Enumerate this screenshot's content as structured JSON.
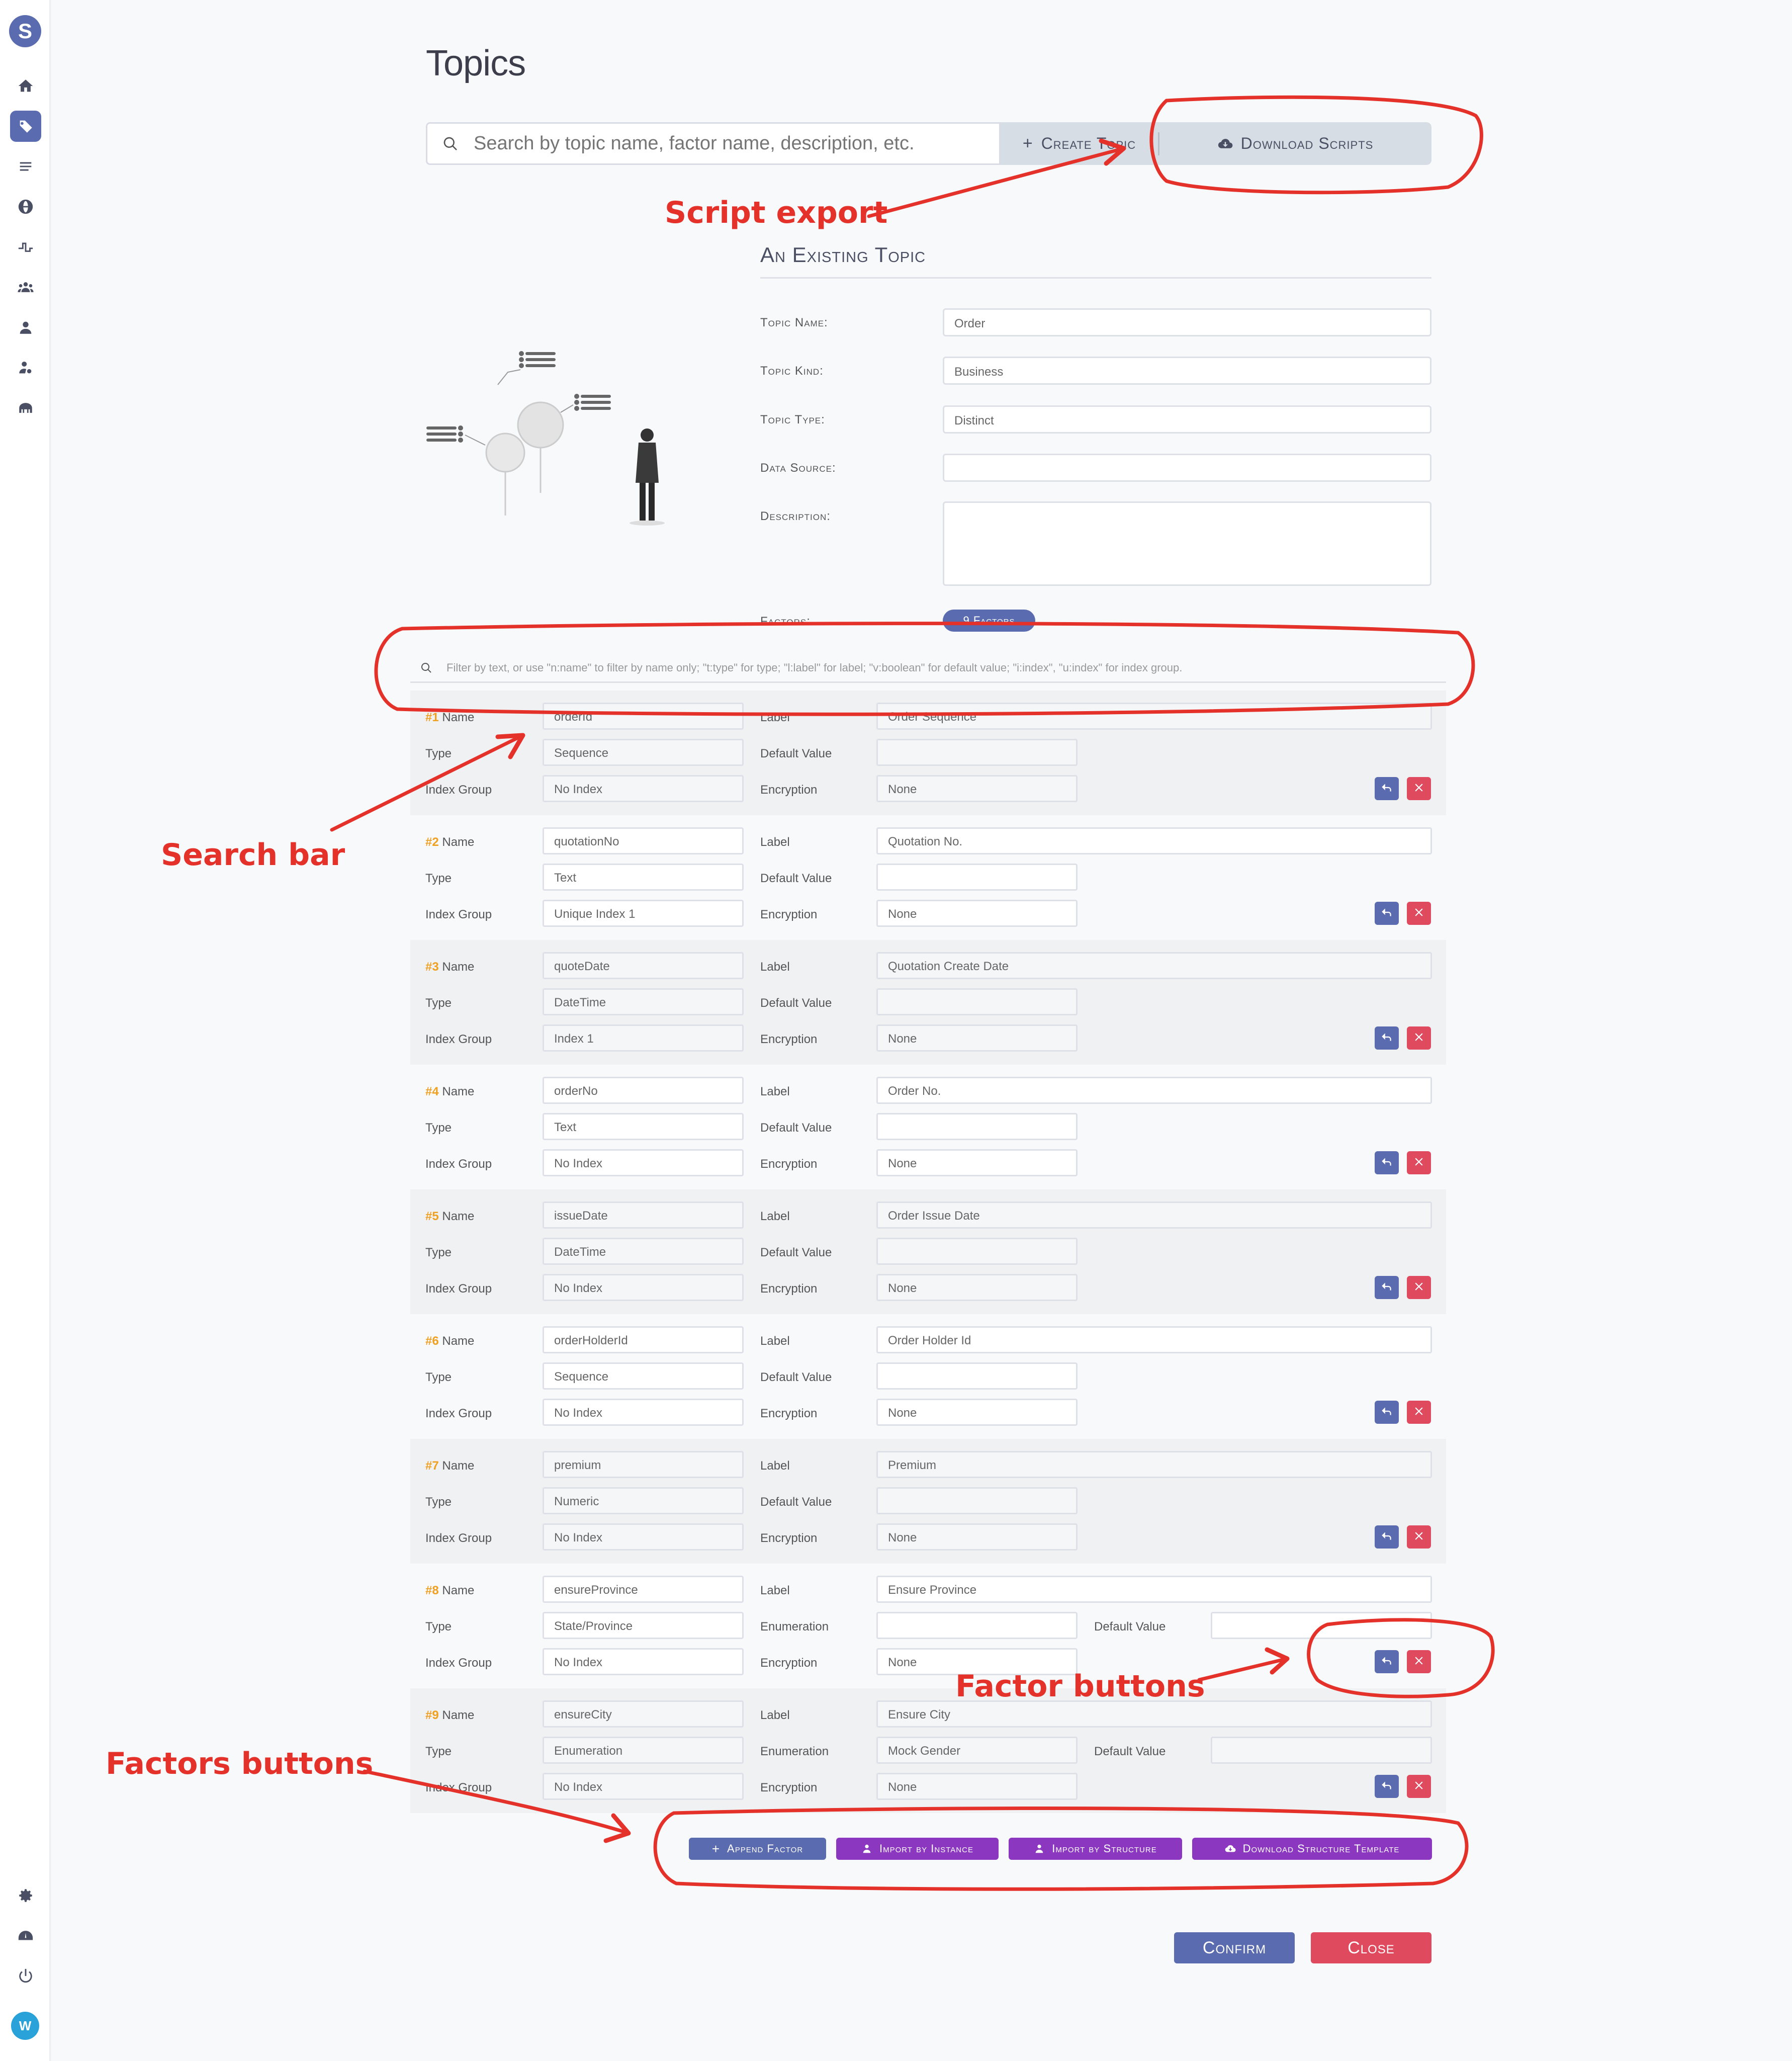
{
  "app": {
    "logo_letter": "S",
    "avatar_letter": "W"
  },
  "header": {
    "title": "Topics",
    "search_placeholder": "Search by topic name, factor name, description, etc.",
    "create_label": "Create Topic",
    "download_label": "Download Scripts"
  },
  "form": {
    "section_title": "An Existing Topic",
    "topic_name_label": "Topic Name:",
    "topic_name_value": "Order",
    "topic_kind_label": "Topic Kind:",
    "topic_kind_value": "Business",
    "topic_type_label": "Topic Type:",
    "topic_type_value": "Distinct",
    "data_source_label": "Data Source:",
    "data_source_value": "",
    "description_label": "Description:",
    "factors_label": "Factors:",
    "factors_badge": "9 Factors"
  },
  "filter": {
    "placeholder": "Filter by text, or use \"n:name\" to filter by name only; \"t:type\" for type; \"l:label\" for label; \"v:boolean\" for default value; \"i:index\", \"u:index\" for index group."
  },
  "labels": {
    "name": "Name",
    "type": "Type",
    "index_group": "Index Group",
    "label": "Label",
    "default_value": "Default Value",
    "encryption": "Encryption",
    "enumeration": "Enumeration"
  },
  "factors": [
    {
      "num": "#1",
      "name": "orderId",
      "type": "Sequence",
      "index": "No Index",
      "label": "Order Sequence",
      "enumeration": "",
      "default": "",
      "encryption": "None"
    },
    {
      "num": "#2",
      "name": "quotationNo",
      "type": "Text",
      "index": "Unique Index 1",
      "label": "Quotation No.",
      "enumeration": "",
      "default": "",
      "encryption": "None"
    },
    {
      "num": "#3",
      "name": "quoteDate",
      "type": "DateTime",
      "index": "Index 1",
      "label": "Quotation Create Date",
      "enumeration": "",
      "default": "",
      "encryption": "None"
    },
    {
      "num": "#4",
      "name": "orderNo",
      "type": "Text",
      "index": "No Index",
      "label": "Order No.",
      "enumeration": "",
      "default": "",
      "encryption": "None"
    },
    {
      "num": "#5",
      "name": "issueDate",
      "type": "DateTime",
      "index": "No Index",
      "label": "Order Issue Date",
      "enumeration": "",
      "default": "",
      "encryption": "None"
    },
    {
      "num": "#6",
      "name": "orderHolderId",
      "type": "Sequence",
      "index": "No Index",
      "label": "Order Holder Id",
      "enumeration": "",
      "default": "",
      "encryption": "None"
    },
    {
      "num": "#7",
      "name": "premium",
      "type": "Numeric",
      "index": "No Index",
      "label": "Premium",
      "enumeration": "",
      "default": "",
      "encryption": "None"
    },
    {
      "num": "#8",
      "name": "ensureProvince",
      "type": "State/Province",
      "index": "No Index",
      "label": "Ensure Province",
      "enumeration": "",
      "default": "",
      "encryption": "None"
    },
    {
      "num": "#9",
      "name": "ensureCity",
      "type": "Enumeration",
      "index": "No Index",
      "label": "Ensure City",
      "enumeration": "Mock Gender",
      "default": "",
      "encryption": "None"
    }
  ],
  "actions": {
    "append": "Append Factor",
    "import_instance": "Import by Instance",
    "import_structure": "Import by Structure",
    "download_template": "Download Structure Template",
    "confirm": "Confirm",
    "close": "Close"
  },
  "annotations": {
    "script_export": "Script export",
    "search_bar": "Search bar",
    "factor_buttons": "Factor buttons",
    "factors_buttons": "Factors buttons"
  },
  "colors": {
    "accent": "#5b6bb0",
    "danger": "#e04a5f",
    "purple": "#8c37c0",
    "annotation": "#e4322b",
    "index_num": "#f0a020"
  }
}
